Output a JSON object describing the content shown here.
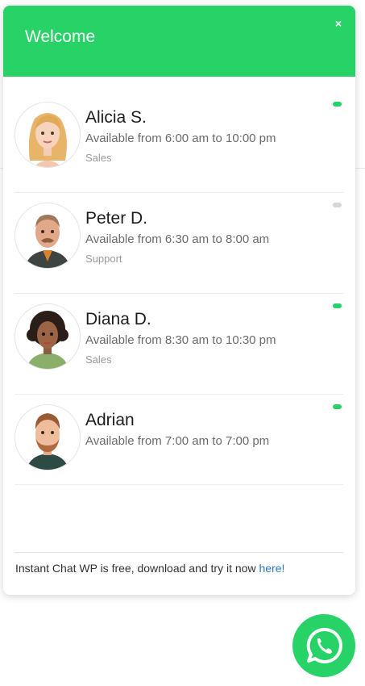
{
  "widget": {
    "title": "Welcome",
    "close_label": "×"
  },
  "agents": [
    {
      "name": "Alicia S.",
      "hours": "Available from 6:00 am to 10:00 pm",
      "department": "Sales",
      "status": "online",
      "status_color": "#27d366"
    },
    {
      "name": "Peter D.",
      "hours": "Available from 6:30 am to 8:00 am",
      "department": "Support",
      "status": "offline",
      "status_color": "#d6d6d6"
    },
    {
      "name": "Diana D.",
      "hours": "Available from 8:30 am to 10:30 pm",
      "department": "Sales",
      "status": "online",
      "status_color": "#27d366"
    },
    {
      "name": "Adrian",
      "hours": "Available from 7:00 am to 7:00 pm",
      "department": "",
      "status": "online",
      "status_color": "#27d366"
    }
  ],
  "footer": {
    "text": "Instant Chat WP is free, download and try it now ",
    "link": "here!"
  },
  "launcher": {
    "icon": "whatsapp-icon"
  },
  "colors": {
    "accent": "#27d366",
    "link": "#2a7ac3"
  }
}
